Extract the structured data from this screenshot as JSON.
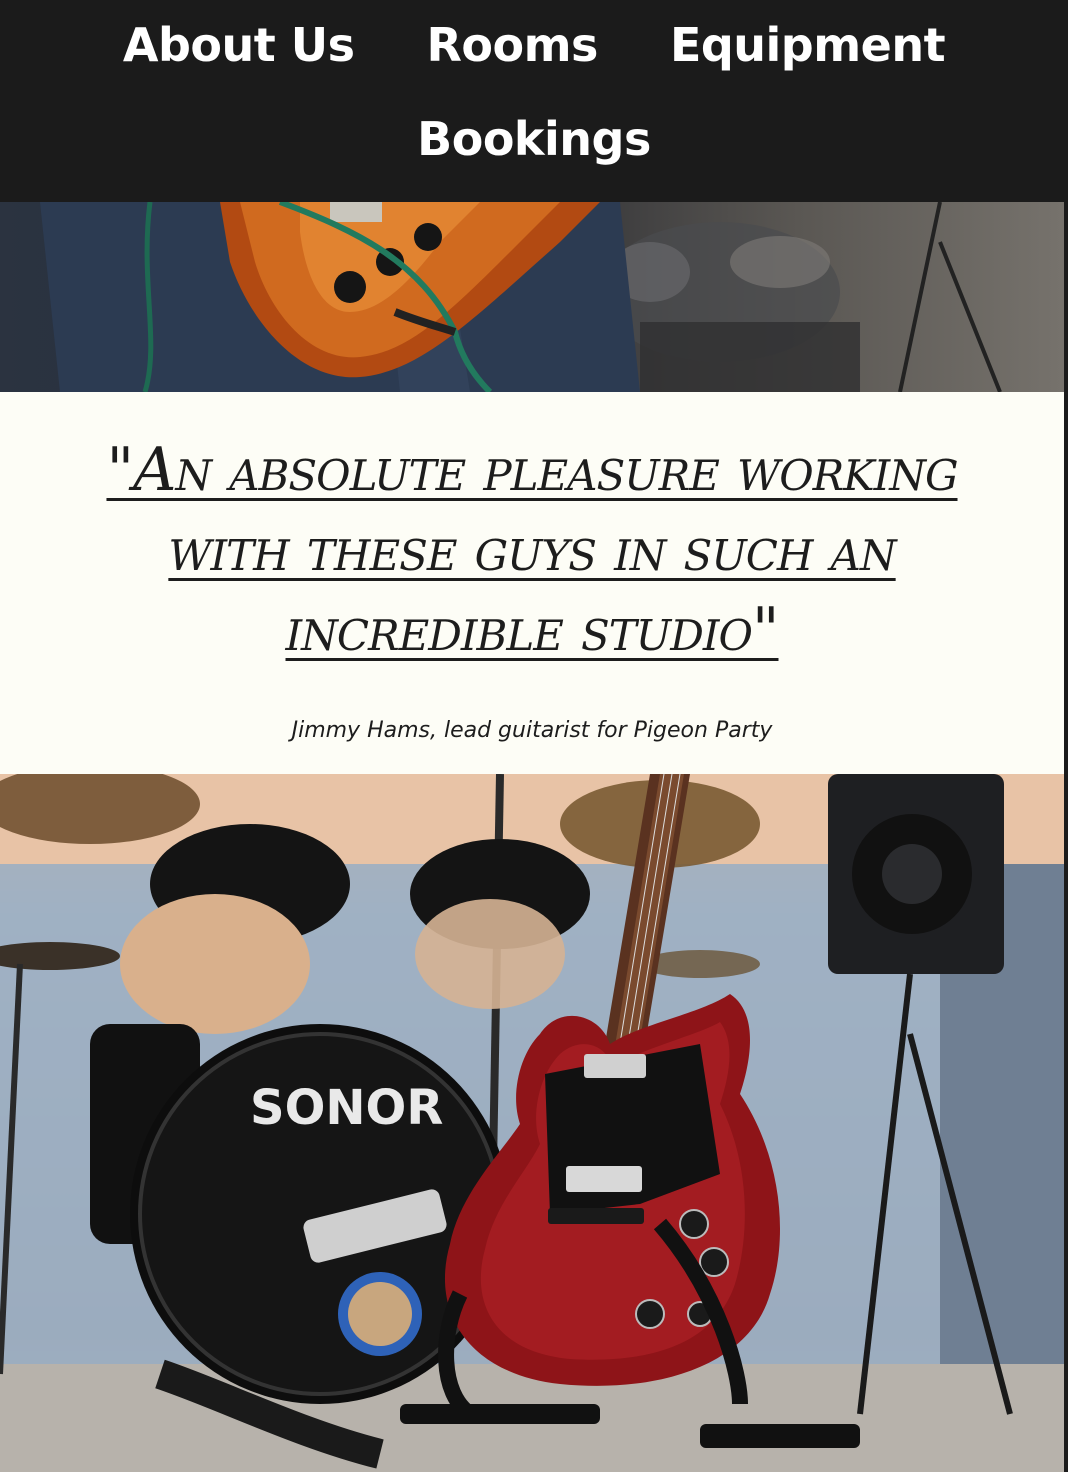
{
  "nav": {
    "items": [
      {
        "label": "About Us"
      },
      {
        "label": "Rooms"
      },
      {
        "label": "Equipment"
      },
      {
        "label": "Bookings"
      }
    ]
  },
  "testimonial": {
    "quote_lines": [
      "\"An absolute pleasure working",
      "with these guys in such an",
      "incredible studio\""
    ],
    "attribution": "Jimmy Hams, lead guitarist for Pigeon Party"
  },
  "photo": {
    "drum_brand": "SONOR"
  },
  "colors": {
    "nav_bg": "#1b1b1b",
    "quote_bg": "#fdfdf6",
    "text": "#1d1d1d",
    "guitar_red": "#8e1418"
  }
}
